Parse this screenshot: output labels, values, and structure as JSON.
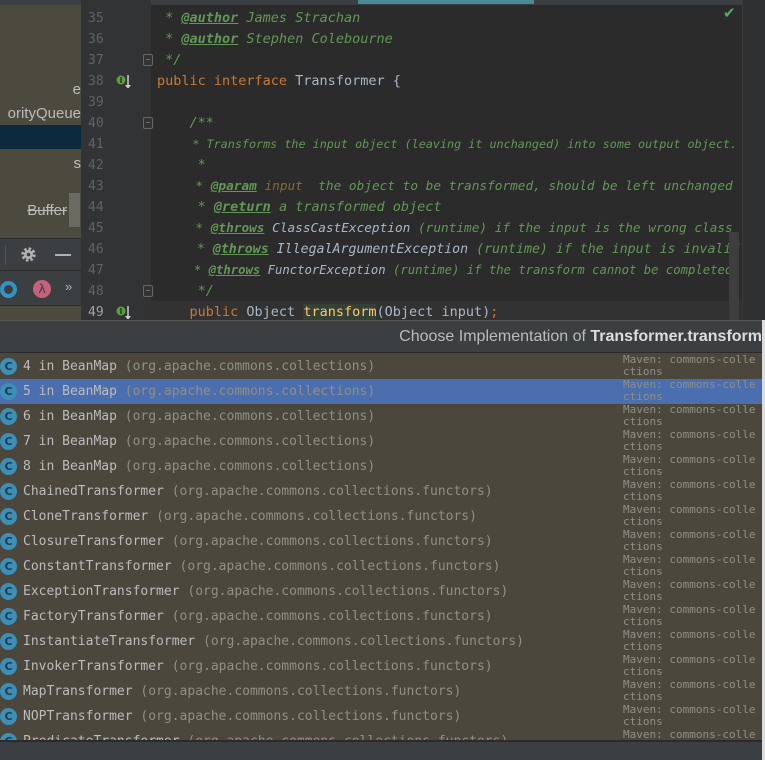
{
  "left_panel": {
    "items": [
      {
        "label": "e",
        "strike": false
      },
      {
        "label": "orityQueue",
        "strike": false
      },
      {
        "label": "s",
        "strike": false
      },
      {
        "label": "Buffer",
        "strike": true
      }
    ],
    "toolbar": {
      "settings_icon": "gear-icon",
      "hide_icon": "minus-icon",
      "more_label": "»"
    }
  },
  "editor": {
    "line_numbers": [
      "35",
      "36",
      "37",
      "38",
      "39",
      "40",
      "41",
      "42",
      "43",
      "44",
      "45",
      "46",
      "47",
      "48",
      "49"
    ],
    "status_icon": "checkmark-icon",
    "lines": [
      [
        {
          "t": " * ",
          "c": "cm"
        },
        {
          "t": "@author",
          "c": "tag"
        },
        {
          "t": " James Strachan",
          "c": "cm"
        }
      ],
      [
        {
          "t": " * ",
          "c": "cm"
        },
        {
          "t": "@author",
          "c": "tag"
        },
        {
          "t": " Stephen Colebourne",
          "c": "cm"
        }
      ],
      [
        {
          "t": " */",
          "c": "cm"
        }
      ],
      [
        {
          "t": "public interface ",
          "c": "kw"
        },
        {
          "t": "Transformer {",
          "c": ""
        }
      ],
      [],
      [
        {
          "t": "    /**",
          "c": "cm"
        }
      ],
      [
        {
          "t": "     * Transforms the input object (leaving it unchanged) into some output object.",
          "c": "cm"
        }
      ],
      [
        {
          "t": "     *",
          "c": "cm"
        }
      ],
      [
        {
          "t": "     * ",
          "c": "cm"
        },
        {
          "t": "@param",
          "c": "tag"
        },
        {
          "t": " input",
          "c": "pr"
        },
        {
          "t": "  the object to be transformed, should be left unchanged",
          "c": "cm"
        }
      ],
      [
        {
          "t": "     * ",
          "c": "cm"
        },
        {
          "t": "@return",
          "c": "tag"
        },
        {
          "t": " a transformed object",
          "c": "cm"
        }
      ],
      [
        {
          "t": "     * ",
          "c": "cm"
        },
        {
          "t": "@throws",
          "c": "tag"
        },
        {
          "t": " ClassCastException",
          "c": "cls"
        },
        {
          "t": " (runtime) if the input is the wrong class",
          "c": "cm"
        }
      ],
      [
        {
          "t": "     * ",
          "c": "cm"
        },
        {
          "t": "@throws",
          "c": "tag"
        },
        {
          "t": " IllegalArgumentException",
          "c": "cls"
        },
        {
          "t": " (runtime) if the input is invalid",
          "c": "cm"
        }
      ],
      [
        {
          "t": "     * ",
          "c": "cm"
        },
        {
          "t": "@throws",
          "c": "tag"
        },
        {
          "t": " FunctorException",
          "c": "cls"
        },
        {
          "t": " (runtime) if the transform cannot be completed",
          "c": "cm"
        }
      ],
      [
        {
          "t": "     */",
          "c": "cm"
        }
      ],
      [
        {
          "t": "    public ",
          "c": "kw"
        },
        {
          "t": "Object ",
          "c": ""
        },
        {
          "t": "transform",
          "c": "mth"
        },
        {
          "t": "(Object input)",
          "c": ""
        },
        {
          "t": ";",
          "c": "kw"
        }
      ]
    ]
  },
  "popup": {
    "title_prefix": "Choose Implementation of ",
    "title_bold": "Transformer.transform",
    "selected_index": 1,
    "items": [
      {
        "name": "4 in BeanMap",
        "package": "(org.apache.commons.collections)",
        "source": "Maven: commons-collections"
      },
      {
        "name": "5 in BeanMap",
        "package": "(org.apache.commons.collections)",
        "source": "Maven: commons-collections"
      },
      {
        "name": "6 in BeanMap",
        "package": "(org.apache.commons.collections)",
        "source": "Maven: commons-collections"
      },
      {
        "name": "7 in BeanMap",
        "package": "(org.apache.commons.collections)",
        "source": "Maven: commons-collections"
      },
      {
        "name": "8 in BeanMap",
        "package": "(org.apache.commons.collections)",
        "source": "Maven: commons-collections"
      },
      {
        "name": "ChainedTransformer",
        "package": "(org.apache.commons.collections.functors)",
        "source": "Maven: commons-collections"
      },
      {
        "name": "CloneTransformer",
        "package": "(org.apache.commons.collections.functors)",
        "source": "Maven: commons-collections"
      },
      {
        "name": "ClosureTransformer",
        "package": "(org.apache.commons.collections.functors)",
        "source": "Maven: commons-collections"
      },
      {
        "name": "ConstantTransformer",
        "package": "(org.apache.commons.collections.functors)",
        "source": "Maven: commons-collections"
      },
      {
        "name": "ExceptionTransformer",
        "package": "(org.apache.commons.collections.functors)",
        "source": "Maven: commons-collections"
      },
      {
        "name": "FactoryTransformer",
        "package": "(org.apache.commons.collections.functors)",
        "source": "Maven: commons-collections"
      },
      {
        "name": "InstantiateTransformer",
        "package": "(org.apache.commons.collections.functors)",
        "source": "Maven: commons-collections"
      },
      {
        "name": "InvokerTransformer",
        "package": "(org.apache.commons.collections.functors)",
        "source": "Maven: commons-collections"
      },
      {
        "name": "MapTransformer",
        "package": "(org.apache.commons.collections.functors)",
        "source": "Maven: commons-collections"
      },
      {
        "name": "NOPTransformer",
        "package": "(org.apache.commons.collections.functors)",
        "source": "Maven: commons-collections"
      },
      {
        "name": "PredicateTransformer",
        "package": "(org.apache.commons.collections.functors)",
        "source": "Maven: commons-collections"
      }
    ],
    "item_icon_letter": "C"
  }
}
